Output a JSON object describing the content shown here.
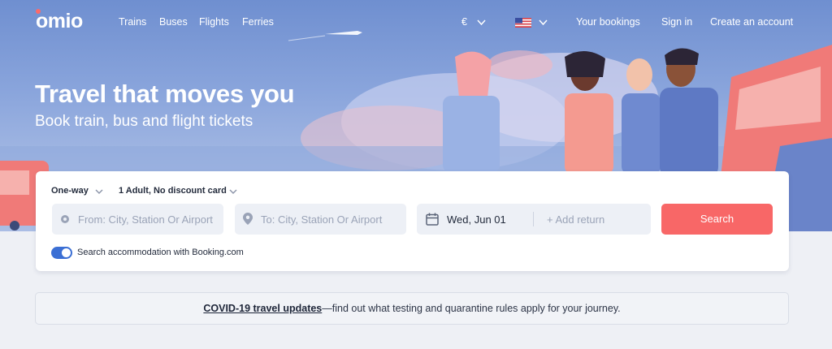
{
  "brand": {
    "name": "omio"
  },
  "nav": {
    "trains": "Trains",
    "buses": "Buses",
    "flights": "Flights",
    "ferries": "Ferries"
  },
  "header_right": {
    "currency": "€",
    "language_flag": "us-flag-icon",
    "bookings": "Your bookings",
    "sign_in": "Sign in",
    "create_account": "Create an account"
  },
  "hero": {
    "title": "Travel that moves you",
    "subtitle": "Book train, bus and flight tickets"
  },
  "search": {
    "trip_type": "One-way",
    "passengers": "1 Adult, No discount card",
    "from_placeholder": "From: City, Station Or Airport",
    "to_placeholder": "To: City, Station Or Airport",
    "date": "Wed, Jun 01",
    "add_return": "+ Add return",
    "button": "Search",
    "accommodation_toggle": {
      "label": "Search accommodation with Booking.com",
      "on": true
    }
  },
  "notice": {
    "link": "COVID-19 travel updates",
    "text": "—find out what testing and quarantine rules apply for your journey."
  },
  "colors": {
    "accent": "#f86767",
    "toggle": "#3b6fd4",
    "text": "#232b3c"
  }
}
